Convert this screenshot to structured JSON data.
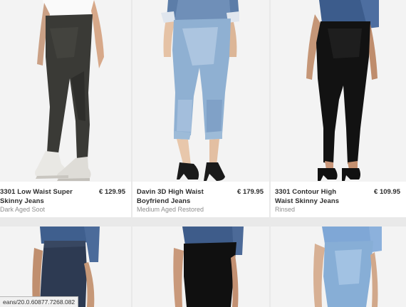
{
  "products": [
    {
      "title_line1": "3301 Low Waist Super",
      "title_line2": "Skinny Jeans",
      "price": "€ 129.95",
      "color": "Dark Aged Soot",
      "image_icon": "model-dark-grey-skinny-jeans"
    },
    {
      "title_line1": "Davin 3D High Waist",
      "title_line2": "Boyfriend Jeans",
      "price": "€ 179.95",
      "color": "Medium Aged Restored",
      "image_icon": "model-light-blue-boyfriend-jeans"
    },
    {
      "title_line1": "3301 Contour High",
      "title_line2": "Waist Skinny Jeans",
      "price": "€ 109.95",
      "color": "Rinsed",
      "image_icon": "model-black-skinny-jeans"
    }
  ],
  "row2": [
    {
      "image_icon": "model-dark-navy-jeans"
    },
    {
      "image_icon": "model-black-jeans"
    },
    {
      "image_icon": "model-light-blue-jeans"
    }
  ],
  "status_bar": {
    "url": "eans/20.0.60877.7268.082"
  },
  "colors": {
    "page_bg": "#e9e9e9",
    "card_bg": "#f4f4f4",
    "text": "#2d2d2d",
    "muted": "#8d8d8d"
  }
}
